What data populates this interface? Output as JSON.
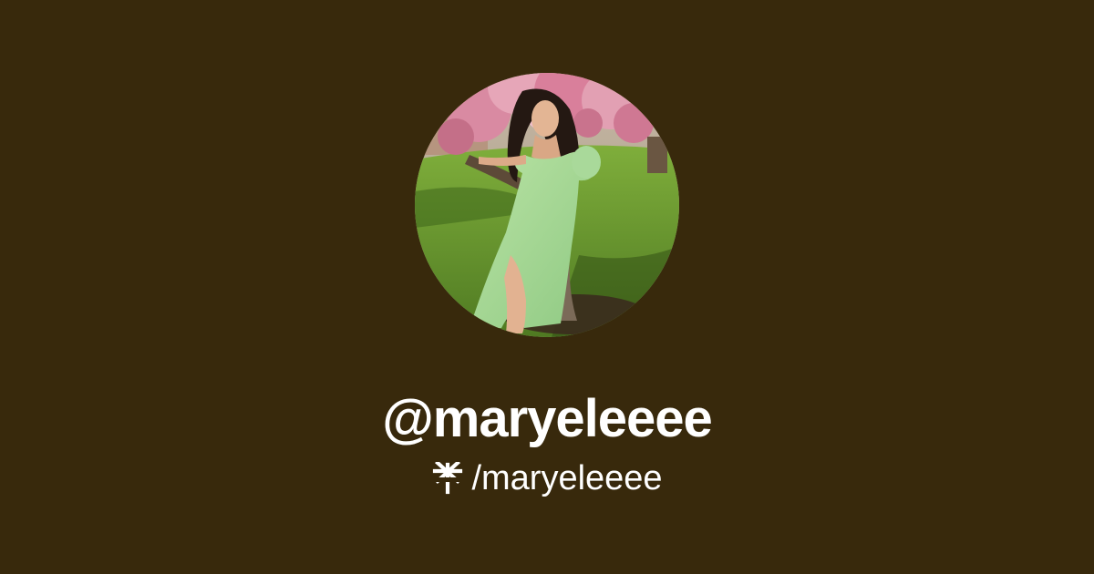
{
  "profile": {
    "handle": "@maryeleeee",
    "link_path": "/maryeleeee",
    "avatar_image": "profile photo of a woman in a light green dress leaning against a tree on a lawn"
  },
  "icons": {
    "brand": "linktree-asterisk-icon"
  },
  "colors": {
    "background": "#38290c",
    "text": "#ffffff"
  }
}
